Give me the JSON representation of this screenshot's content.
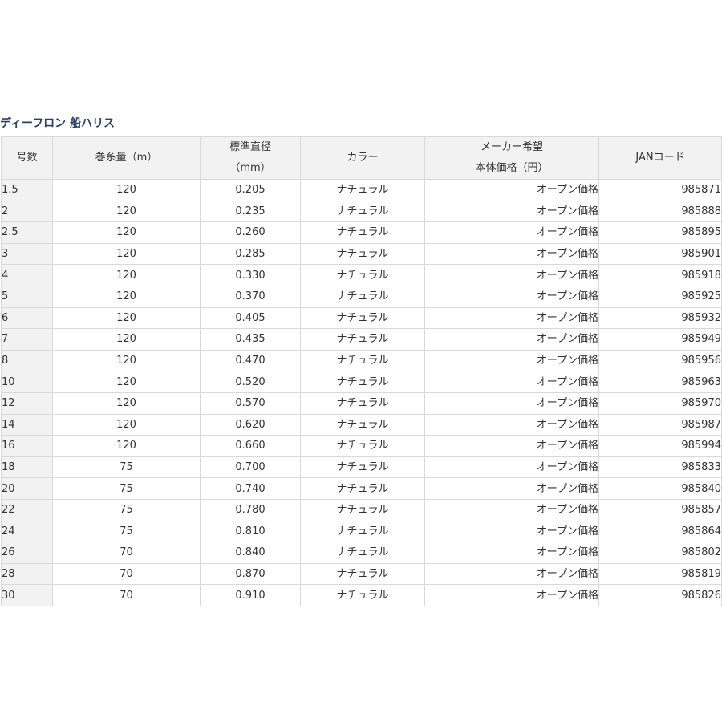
{
  "title": "ディーフロン 船ハリス",
  "headers": {
    "number": "号数",
    "length": "巻糸量（m）",
    "diameter_line1": "標準直径",
    "diameter_line2": "（mm）",
    "color": "カラー",
    "price_line1": "メーカー希望",
    "price_line2": "本体価格（円）",
    "jan": "JANコード"
  },
  "rows": [
    {
      "number": "1.5",
      "length": "120",
      "diameter": "0.205",
      "color": "ナチュラル",
      "price": "オープン価格",
      "jan": "985871"
    },
    {
      "number": "2",
      "length": "120",
      "diameter": "0.235",
      "color": "ナチュラル",
      "price": "オープン価格",
      "jan": "985888"
    },
    {
      "number": "2.5",
      "length": "120",
      "diameter": "0.260",
      "color": "ナチュラル",
      "price": "オープン価格",
      "jan": "985895"
    },
    {
      "number": "3",
      "length": "120",
      "diameter": "0.285",
      "color": "ナチュラル",
      "price": "オープン価格",
      "jan": "985901"
    },
    {
      "number": "4",
      "length": "120",
      "diameter": "0.330",
      "color": "ナチュラル",
      "price": "オープン価格",
      "jan": "985918"
    },
    {
      "number": "5",
      "length": "120",
      "diameter": "0.370",
      "color": "ナチュラル",
      "price": "オープン価格",
      "jan": "985925"
    },
    {
      "number": "6",
      "length": "120",
      "diameter": "0.405",
      "color": "ナチュラル",
      "price": "オープン価格",
      "jan": "985932"
    },
    {
      "number": "7",
      "length": "120",
      "diameter": "0.435",
      "color": "ナチュラル",
      "price": "オープン価格",
      "jan": "985949"
    },
    {
      "number": "8",
      "length": "120",
      "diameter": "0.470",
      "color": "ナチュラル",
      "price": "オープン価格",
      "jan": "985956"
    },
    {
      "number": "10",
      "length": "120",
      "diameter": "0.520",
      "color": "ナチュラル",
      "price": "オープン価格",
      "jan": "985963"
    },
    {
      "number": "12",
      "length": "120",
      "diameter": "0.570",
      "color": "ナチュラル",
      "price": "オープン価格",
      "jan": "985970"
    },
    {
      "number": "14",
      "length": "120",
      "diameter": "0.620",
      "color": "ナチュラル",
      "price": "オープン価格",
      "jan": "985987"
    },
    {
      "number": "16",
      "length": "120",
      "diameter": "0.660",
      "color": "ナチュラル",
      "price": "オープン価格",
      "jan": "985994"
    },
    {
      "number": "18",
      "length": "75",
      "diameter": "0.700",
      "color": "ナチュラル",
      "price": "オープン価格",
      "jan": "985833"
    },
    {
      "number": "20",
      "length": "75",
      "diameter": "0.740",
      "color": "ナチュラル",
      "price": "オープン価格",
      "jan": "985840"
    },
    {
      "number": "22",
      "length": "75",
      "diameter": "0.780",
      "color": "ナチュラル",
      "price": "オープン価格",
      "jan": "985857"
    },
    {
      "number": "24",
      "length": "75",
      "diameter": "0.810",
      "color": "ナチュラル",
      "price": "オープン価格",
      "jan": "985864"
    },
    {
      "number": "26",
      "length": "70",
      "diameter": "0.840",
      "color": "ナチュラル",
      "price": "オープン価格",
      "jan": "985802"
    },
    {
      "number": "28",
      "length": "70",
      "diameter": "0.870",
      "color": "ナチュラル",
      "price": "オープン価格",
      "jan": "985819"
    },
    {
      "number": "30",
      "length": "70",
      "diameter": "0.910",
      "color": "ナチュラル",
      "price": "オープン価格",
      "jan": "985826"
    }
  ]
}
